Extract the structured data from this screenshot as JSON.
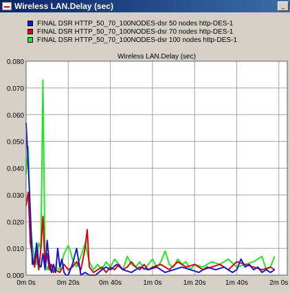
{
  "window": {
    "title": "Wireless LAN.Delay (sec)"
  },
  "colors": {
    "series_50": "#1414d2",
    "series_70": "#e00000",
    "series_100": "#1ee61e",
    "plot_bg": "#ffffff",
    "grid": "#a0a0a0"
  },
  "legend": [
    {
      "label": "FINAL DSR HTTP_50_70_100NODES-dsr 50 nodes http-DES-1",
      "color": "#1414d2"
    },
    {
      "label": "FINAL DSR HTTP_50_70_100NODES-dsr 70 nodes http-DES-1",
      "color": "#e00000"
    },
    {
      "label": "FINAL DSR HTTP_50_70_100NODES-dsr 100 nodes http-DES-1",
      "color": "#1ee61e"
    }
  ],
  "chart_data": {
    "type": "line",
    "title": "Wireless LAN.Delay (sec)",
    "xlabel": "",
    "ylabel": "",
    "xlim": [
      0,
      124
    ],
    "ylim": [
      0,
      0.08
    ],
    "x_ticks": [
      {
        "value": 0,
        "label": "0m 0s"
      },
      {
        "value": 20,
        "label": "0m 20s"
      },
      {
        "value": 40,
        "label": "0m 40s"
      },
      {
        "value": 60,
        "label": "1m 0s"
      },
      {
        "value": 80,
        "label": "1m 20s"
      },
      {
        "value": 100,
        "label": "1m 40s"
      },
      {
        "value": 120,
        "label": "2m 0s"
      }
    ],
    "y_ticks": [
      {
        "value": 0.0,
        "label": "0.000"
      },
      {
        "value": 0.01,
        "label": "0.010"
      },
      {
        "value": 0.02,
        "label": "0.020"
      },
      {
        "value": 0.03,
        "label": "0.030"
      },
      {
        "value": 0.04,
        "label": "0.040"
      },
      {
        "value": 0.05,
        "label": "0.050"
      },
      {
        "value": 0.06,
        "label": "0.060"
      },
      {
        "value": 0.07,
        "label": "0.070"
      },
      {
        "value": 0.08,
        "label": "0.080"
      }
    ],
    "grid": true,
    "legend_position": "top",
    "series": [
      {
        "name": "FINAL DSR HTTP_50_70_100NODES-dsr 50 nodes http-DES-1",
        "color": "#1414d2",
        "x": [
          0,
          1,
          2,
          3,
          4,
          5,
          6,
          7,
          8,
          9,
          10,
          11,
          12,
          13,
          14,
          15,
          16,
          17,
          18,
          19,
          20,
          22,
          24,
          26,
          28,
          30,
          33,
          36,
          38,
          40,
          43,
          46,
          50,
          54,
          58,
          62,
          66,
          70,
          74,
          78,
          82,
          86,
          90,
          94,
          98,
          100,
          102,
          104,
          106,
          108,
          110,
          112,
          114,
          116,
          118
        ],
        "y": [
          0.057,
          0.041,
          0.024,
          0.004,
          0.005,
          0.012,
          0.004,
          0.003,
          0.008,
          0.002,
          0.013,
          0.005,
          0.001,
          0.004,
          0.001,
          0.01,
          0.003,
          0.006,
          0.001,
          0.0,
          0.0,
          0.004,
          0.01,
          0.0,
          0.001,
          0.0,
          0.0,
          0.002,
          0.003,
          0.002,
          0.004,
          0.002,
          0.001,
          0.003,
          0.002,
          0.003,
          0.001,
          0.002,
          0.003,
          0.002,
          0.001,
          0.003,
          0.002,
          0.003,
          0.001,
          0.002,
          0.006,
          0.003,
          0.004,
          0.002,
          0.003,
          0.001,
          0.002,
          0.001,
          0.002
        ]
      },
      {
        "name": "FINAL DSR HTTP_50_70_100NODES-dsr 70 nodes http-DES-1",
        "color": "#e00000",
        "x": [
          0,
          1,
          2,
          3,
          4,
          5,
          6,
          7,
          8,
          9,
          10,
          11,
          12,
          13,
          14,
          16,
          18,
          20,
          22,
          24,
          26,
          28,
          29,
          30,
          32,
          34,
          36,
          38,
          40,
          42,
          44,
          46,
          48,
          50,
          52,
          54,
          56,
          58,
          60,
          64,
          68,
          72,
          76,
          80,
          84,
          88,
          92,
          96,
          100,
          104,
          108,
          112,
          116,
          118
        ],
        "y": [
          0.026,
          0.031,
          0.012,
          0.007,
          0.003,
          0.009,
          0.002,
          0.01,
          0.022,
          0.003,
          0.008,
          0.002,
          0.004,
          0.001,
          0.002,
          0.001,
          0.004,
          0.002,
          0.003,
          0.005,
          0.002,
          0.01,
          0.017,
          0.003,
          0.001,
          0.002,
          0.003,
          0.001,
          0.003,
          0.002,
          0.004,
          0.002,
          0.003,
          0.005,
          0.003,
          0.002,
          0.004,
          0.002,
          0.003,
          0.004,
          0.002,
          0.005,
          0.003,
          0.004,
          0.002,
          0.003,
          0.004,
          0.002,
          0.005,
          0.004,
          0.003,
          0.002,
          0.003,
          0.002
        ]
      },
      {
        "name": "FINAL DSR HTTP_50_70_100NODES-dsr 100 nodes http-DES-1",
        "color": "#1ee61e",
        "x": [
          0,
          1,
          2,
          3,
          4,
          5,
          6,
          7,
          8,
          9,
          10,
          11,
          12,
          14,
          16,
          18,
          20,
          21,
          22,
          24,
          26,
          28,
          30,
          32,
          34,
          36,
          38,
          40,
          42,
          44,
          46,
          48,
          50,
          52,
          54,
          56,
          58,
          60,
          62,
          64,
          66,
          68,
          70,
          72,
          74,
          76,
          78,
          80,
          84,
          88,
          92,
          96,
          100,
          104,
          108,
          112,
          114,
          116,
          118
        ],
        "y": [
          0.038,
          0.048,
          0.02,
          0.011,
          0.006,
          0.004,
          0.012,
          0.01,
          0.073,
          0.005,
          0.002,
          0.004,
          0.001,
          0.003,
          0.002,
          0.008,
          0.011,
          0.009,
          0.006,
          0.003,
          0.007,
          0.012,
          0.005,
          0.002,
          0.004,
          0.002,
          0.005,
          0.003,
          0.006,
          0.004,
          0.002,
          0.007,
          0.004,
          0.003,
          0.005,
          0.002,
          0.004,
          0.006,
          0.003,
          0.005,
          0.009,
          0.004,
          0.003,
          0.006,
          0.004,
          0.005,
          0.002,
          0.004,
          0.003,
          0.005,
          0.004,
          0.006,
          0.003,
          0.004,
          0.005,
          0.007,
          0.002,
          0.003,
          0.007
        ]
      }
    ]
  }
}
